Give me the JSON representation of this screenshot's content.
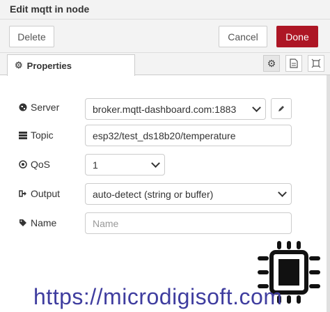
{
  "window": {
    "title": "Edit mqtt in node"
  },
  "toolbar": {
    "delete_label": "Delete",
    "cancel_label": "Cancel",
    "done_label": "Done"
  },
  "tabs": {
    "properties_label": "Properties"
  },
  "form": {
    "server": {
      "label": "Server",
      "value": "broker.mqtt-dashboard.com:1883"
    },
    "topic": {
      "label": "Topic",
      "value": "esp32/test_ds18b20/temperature"
    },
    "qos": {
      "label": "QoS",
      "value": "1"
    },
    "output": {
      "label": "Output",
      "value": "auto-detect (string or buffer)"
    },
    "name": {
      "label": "Name",
      "placeholder": "Name"
    }
  },
  "watermark": {
    "url": "https://microdigisoft.com"
  },
  "colors": {
    "done": "#ad1625",
    "url": "#3f3d9f"
  }
}
